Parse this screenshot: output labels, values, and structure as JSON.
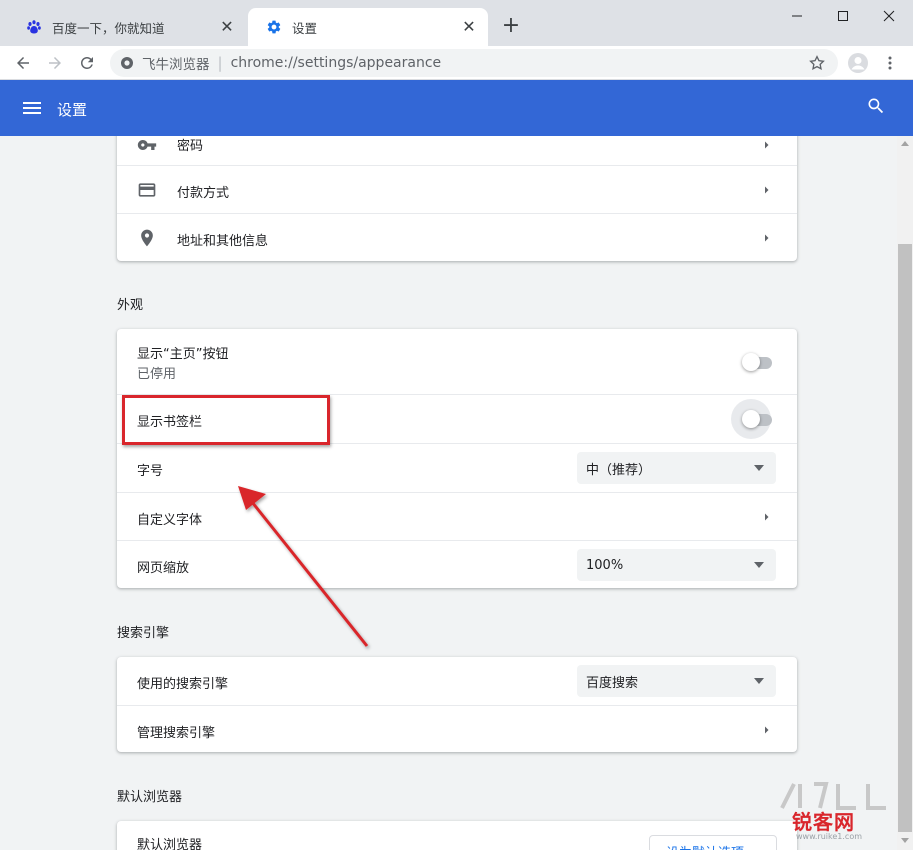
{
  "tabs": [
    {
      "title": "百度一下，你就知道",
      "icon": "baidu-paw-icon",
      "active": false
    },
    {
      "title": "设置",
      "icon": "settings-gear-icon",
      "active": true
    }
  ],
  "toolbar": {
    "site_name": "飞牛浏览器",
    "url": "chrome://settings/appearance"
  },
  "header": {
    "title": "设置"
  },
  "autofill": {
    "items": [
      {
        "label": "密码",
        "icon": "key-icon"
      },
      {
        "label": "付款方式",
        "icon": "credit-card-icon"
      },
      {
        "label": "地址和其他信息",
        "icon": "location-pin-icon"
      }
    ]
  },
  "appearance": {
    "title": "外观",
    "home_button": {
      "label": "显示“主页”按钮",
      "status": "已停用",
      "enabled": false
    },
    "bookmarks_bar": {
      "label": "显示书签栏",
      "enabled": false
    },
    "font_size": {
      "label": "字号",
      "value": "中（推荐）"
    },
    "custom_fonts": {
      "label": "自定义字体"
    },
    "page_zoom": {
      "label": "网页缩放",
      "value": "100%"
    }
  },
  "search_engine": {
    "title": "搜索引擎",
    "used": {
      "label": "使用的搜索引擎",
      "value": "百度搜索"
    },
    "manage": {
      "label": "管理搜索引擎"
    }
  },
  "default_browser": {
    "title": "默认浏览器",
    "row_label": "默认浏览器",
    "button": "设为默认选项"
  },
  "watermark": {
    "text": "锐客网",
    "sub": "www.ruike1.com"
  },
  "colors": {
    "header_blue": "#3367d6",
    "annotation_red": "#d9262c",
    "link_blue": "#1a73e8"
  }
}
